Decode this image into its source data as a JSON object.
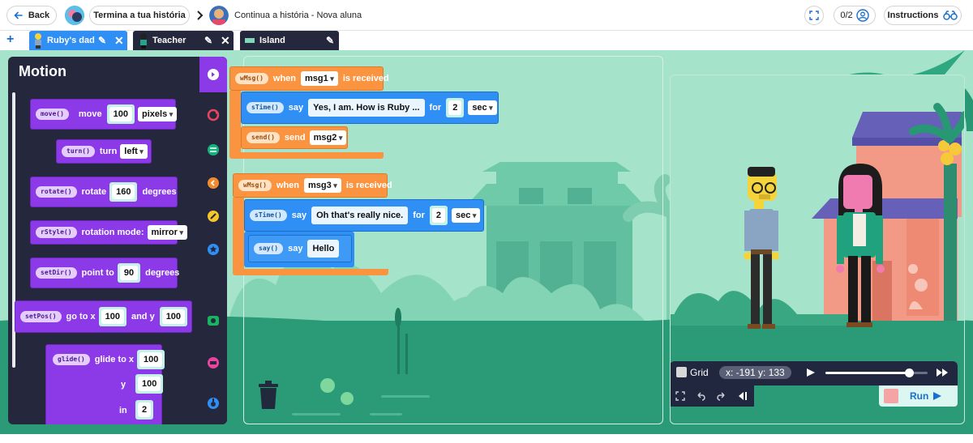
{
  "header": {
    "back_label": "Back",
    "project_title": "Termina a tua história",
    "activity_title": "Continua a história - Nova aluna",
    "progress": "0/2",
    "instructions_label": "Instructions"
  },
  "tabs": [
    {
      "label": "Ruby's dad"
    },
    {
      "label": "Teacher"
    },
    {
      "label": "Island"
    }
  ],
  "palette": {
    "title": "Motion",
    "categories": [
      "motion",
      "control",
      "operators",
      "sound",
      "pen",
      "looks",
      "sensing",
      "variables",
      "events"
    ],
    "blocks": {
      "move": {
        "fn": "move()",
        "label": "move",
        "value": "100",
        "unit": "pixels"
      },
      "turn": {
        "fn": "turn()",
        "label": "turn",
        "value": "left"
      },
      "rotate": {
        "fn": "rotate()",
        "label": "rotate",
        "value": "160",
        "unit": "degrees"
      },
      "rstyle": {
        "fn": "rStyle()",
        "label": "rotation mode:",
        "value": "mirror"
      },
      "setdir": {
        "fn": "setDir()",
        "label": "point to",
        "value": "90",
        "unit": "degrees"
      },
      "setpos": {
        "fn": "setPos()",
        "label": "go to x",
        "x": "100",
        "and_y": "and y",
        "y": "100"
      },
      "glide": {
        "fn": "glide()",
        "label": "glide to x",
        "x": "100",
        "y_label": "y",
        "y": "100",
        "in_label": "in",
        "in": "2"
      }
    }
  },
  "script1": {
    "hat": {
      "fn": "wMsg()",
      "when": "when",
      "msg": "msg1",
      "received": "is received"
    },
    "say": {
      "fn": "sTime()",
      "say": "say",
      "text": "Yes, I am. How is Ruby ...",
      "for": "for",
      "secs": "2",
      "unit": "sec"
    },
    "send": {
      "fn": "send()",
      "label": "send",
      "msg": "msg2"
    }
  },
  "script2": {
    "hat": {
      "fn": "wMsg()",
      "when": "when",
      "msg": "msg3",
      "received": "is received"
    },
    "say": {
      "fn": "sTime()",
      "say": "say",
      "text": "Oh that's really nice.",
      "for": "for",
      "secs": "2",
      "unit": "sec"
    },
    "say2": {
      "fn": "say()",
      "say": "say",
      "text": "Hello"
    }
  },
  "stage": {
    "grid_label": "Grid",
    "coords": "x: -191 y: 133",
    "run_label": "Run",
    "volume": 0.82
  },
  "colors": {
    "motion": "#8c3ae8",
    "events": "#fb9440",
    "looks": "#2f8ff4",
    "stage_bg": "#a6e3cb",
    "palette_bg": "#25283d"
  }
}
